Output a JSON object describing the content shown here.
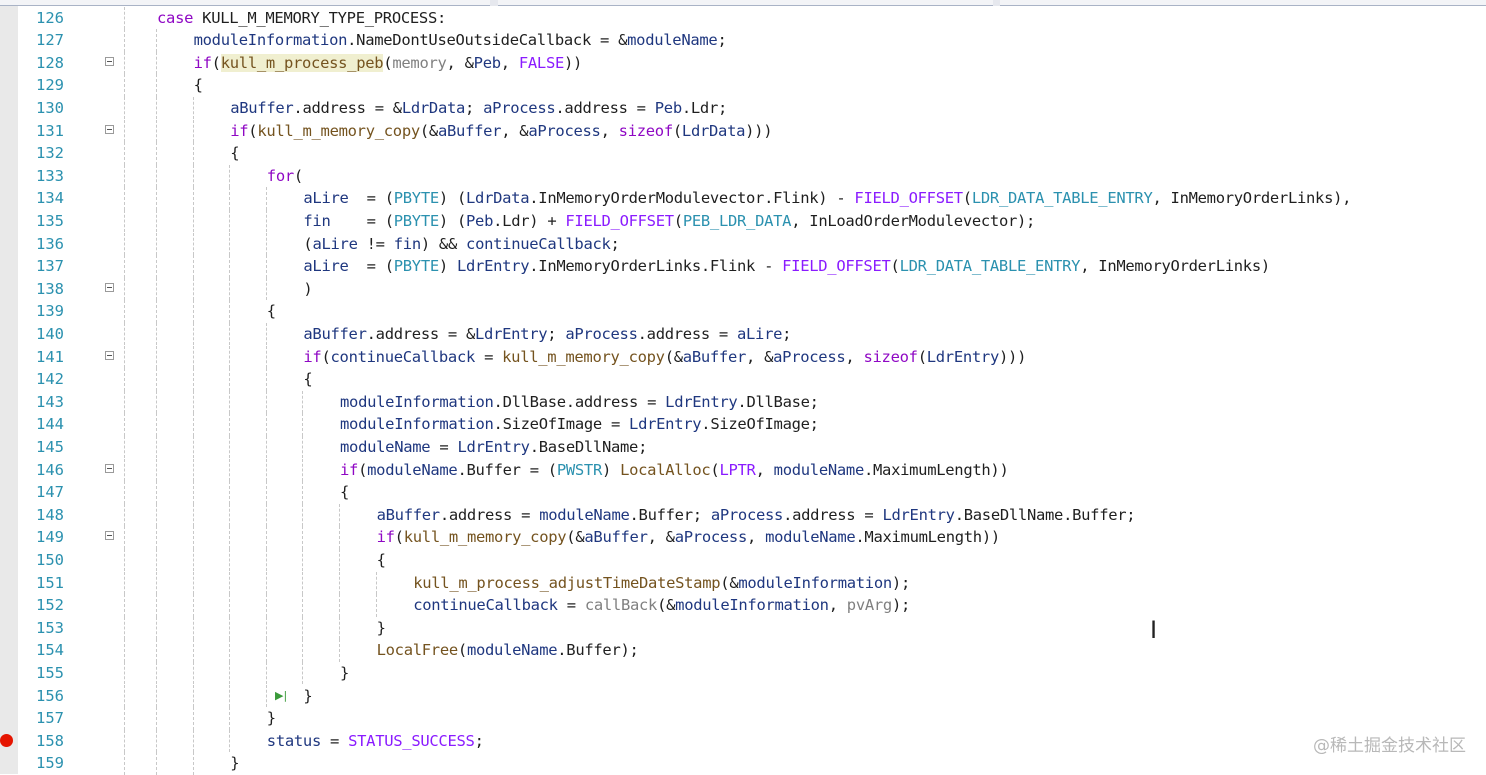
{
  "editor": {
    "lines": [
      {
        "num": "126",
        "indent": 0,
        "tokens": [
          [
            "kw",
            "case"
          ],
          [
            "pl",
            " KULL_M_MEMORY_TYPE_PROCESS:"
          ]
        ]
      },
      {
        "num": "127",
        "indent": 1,
        "tokens": [
          [
            "var",
            "moduleInformation"
          ],
          [
            "pl",
            ".NameDontUseOutsideCallback = &"
          ],
          [
            "var",
            "moduleName"
          ],
          [
            "pl",
            ";"
          ]
        ]
      },
      {
        "num": "128",
        "indent": 1,
        "fold": true,
        "tokens": [
          [
            "kw",
            "if"
          ],
          [
            "pl",
            "("
          ],
          [
            "fnhl",
            "kull_m_process_peb"
          ],
          [
            "pl",
            "("
          ],
          [
            "gray",
            "memory"
          ],
          [
            "pl",
            ", &"
          ],
          [
            "var",
            "Peb"
          ],
          [
            "pl",
            ", "
          ],
          [
            "mac",
            "FALSE"
          ],
          [
            "pl",
            "))"
          ]
        ]
      },
      {
        "num": "129",
        "indent": 1,
        "tokens": [
          [
            "pl",
            "{"
          ]
        ]
      },
      {
        "num": "130",
        "indent": 2,
        "tokens": [
          [
            "var",
            "aBuffer"
          ],
          [
            "pl",
            ".address = &"
          ],
          [
            "var",
            "LdrData"
          ],
          [
            "pl",
            "; "
          ],
          [
            "var",
            "aProcess"
          ],
          [
            "pl",
            ".address = "
          ],
          [
            "var",
            "Peb"
          ],
          [
            "pl",
            ".Ldr;"
          ]
        ]
      },
      {
        "num": "131",
        "indent": 2,
        "fold": true,
        "tokens": [
          [
            "kw",
            "if"
          ],
          [
            "pl",
            "("
          ],
          [
            "fn",
            "kull_m_memory_copy"
          ],
          [
            "pl",
            "(&"
          ],
          [
            "var",
            "aBuffer"
          ],
          [
            "pl",
            ", &"
          ],
          [
            "var",
            "aProcess"
          ],
          [
            "pl",
            ", "
          ],
          [
            "kw",
            "sizeof"
          ],
          [
            "pl",
            "("
          ],
          [
            "var",
            "LdrData"
          ],
          [
            "pl",
            ")))"
          ]
        ]
      },
      {
        "num": "132",
        "indent": 2,
        "tokens": [
          [
            "pl",
            "{"
          ]
        ]
      },
      {
        "num": "133",
        "indent": 3,
        "tokens": [
          [
            "kw",
            "for"
          ],
          [
            "pl",
            "("
          ]
        ]
      },
      {
        "num": "134",
        "indent": 4,
        "tokens": [
          [
            "var",
            "aLire"
          ],
          [
            "pl",
            "  = ("
          ],
          [
            "typ",
            "PBYTE"
          ],
          [
            "pl",
            ") ("
          ],
          [
            "var",
            "LdrData"
          ],
          [
            "pl",
            ".InMemoryOrderModulevector.Flink) - "
          ],
          [
            "mac",
            "FIELD_OFFSET"
          ],
          [
            "pl",
            "("
          ],
          [
            "typ",
            "LDR_DATA_TABLE_ENTRY"
          ],
          [
            "pl",
            ", InMemoryOrderLinks),"
          ]
        ]
      },
      {
        "num": "135",
        "indent": 4,
        "tokens": [
          [
            "var",
            "fin"
          ],
          [
            "pl",
            "    = ("
          ],
          [
            "typ",
            "PBYTE"
          ],
          [
            "pl",
            ") ("
          ],
          [
            "var",
            "Peb"
          ],
          [
            "pl",
            ".Ldr) + "
          ],
          [
            "mac",
            "FIELD_OFFSET"
          ],
          [
            "pl",
            "("
          ],
          [
            "typ",
            "PEB_LDR_DATA"
          ],
          [
            "pl",
            ", InLoadOrderModulevector);"
          ]
        ]
      },
      {
        "num": "136",
        "indent": 4,
        "tokens": [
          [
            "pl",
            "("
          ],
          [
            "var",
            "aLire"
          ],
          [
            "pl",
            " != "
          ],
          [
            "var",
            "fin"
          ],
          [
            "pl",
            ") && "
          ],
          [
            "var",
            "continueCallback"
          ],
          [
            "pl",
            ";"
          ]
        ]
      },
      {
        "num": "137",
        "indent": 4,
        "tokens": [
          [
            "var",
            "aLire"
          ],
          [
            "pl",
            "  = ("
          ],
          [
            "typ",
            "PBYTE"
          ],
          [
            "pl",
            ") "
          ],
          [
            "var",
            "LdrEntry"
          ],
          [
            "pl",
            ".InMemoryOrderLinks.Flink - "
          ],
          [
            "mac",
            "FIELD_OFFSET"
          ],
          [
            "pl",
            "("
          ],
          [
            "typ",
            "LDR_DATA_TABLE_ENTRY"
          ],
          [
            "pl",
            ", InMemoryOrderLinks)"
          ]
        ]
      },
      {
        "num": "138",
        "indent": 4,
        "fold": true,
        "tokens": [
          [
            "pl",
            ")"
          ]
        ]
      },
      {
        "num": "139",
        "indent": 3,
        "tokens": [
          [
            "pl",
            "{"
          ]
        ]
      },
      {
        "num": "140",
        "indent": 4,
        "tokens": [
          [
            "var",
            "aBuffer"
          ],
          [
            "pl",
            ".address = &"
          ],
          [
            "var",
            "LdrEntry"
          ],
          [
            "pl",
            "; "
          ],
          [
            "var",
            "aProcess"
          ],
          [
            "pl",
            ".address = "
          ],
          [
            "var",
            "aLire"
          ],
          [
            "pl",
            ";"
          ]
        ]
      },
      {
        "num": "141",
        "indent": 4,
        "fold": true,
        "tokens": [
          [
            "kw",
            "if"
          ],
          [
            "pl",
            "("
          ],
          [
            "var",
            "continueCallback"
          ],
          [
            "pl",
            " = "
          ],
          [
            "fn",
            "kull_m_memory_copy"
          ],
          [
            "pl",
            "(&"
          ],
          [
            "var",
            "aBuffer"
          ],
          [
            "pl",
            ", &"
          ],
          [
            "var",
            "aProcess"
          ],
          [
            "pl",
            ", "
          ],
          [
            "kw",
            "sizeof"
          ],
          [
            "pl",
            "("
          ],
          [
            "var",
            "LdrEntry"
          ],
          [
            "pl",
            ")))"
          ]
        ]
      },
      {
        "num": "142",
        "indent": 4,
        "tokens": [
          [
            "pl",
            "{"
          ]
        ]
      },
      {
        "num": "143",
        "indent": 5,
        "tokens": [
          [
            "var",
            "moduleInformation"
          ],
          [
            "pl",
            ".DllBase.address = "
          ],
          [
            "var",
            "LdrEntry"
          ],
          [
            "pl",
            ".DllBase;"
          ]
        ]
      },
      {
        "num": "144",
        "indent": 5,
        "tokens": [
          [
            "var",
            "moduleInformation"
          ],
          [
            "pl",
            ".SizeOfImage = "
          ],
          [
            "var",
            "LdrEntry"
          ],
          [
            "pl",
            ".SizeOfImage;"
          ]
        ]
      },
      {
        "num": "145",
        "indent": 5,
        "tokens": [
          [
            "var",
            "moduleName"
          ],
          [
            "pl",
            " = "
          ],
          [
            "var",
            "LdrEntry"
          ],
          [
            "pl",
            ".BaseDllName;"
          ]
        ]
      },
      {
        "num": "146",
        "indent": 5,
        "fold": true,
        "tokens": [
          [
            "kw",
            "if"
          ],
          [
            "pl",
            "("
          ],
          [
            "var",
            "moduleName"
          ],
          [
            "pl",
            ".Buffer = ("
          ],
          [
            "typ",
            "PWSTR"
          ],
          [
            "pl",
            ") "
          ],
          [
            "fn",
            "LocalAlloc"
          ],
          [
            "pl",
            "("
          ],
          [
            "mac",
            "LPTR"
          ],
          [
            "pl",
            ", "
          ],
          [
            "var",
            "moduleName"
          ],
          [
            "pl",
            ".MaximumLength))"
          ]
        ]
      },
      {
        "num": "147",
        "indent": 5,
        "tokens": [
          [
            "pl",
            "{"
          ]
        ]
      },
      {
        "num": "148",
        "indent": 6,
        "tokens": [
          [
            "var",
            "aBuffer"
          ],
          [
            "pl",
            ".address = "
          ],
          [
            "var",
            "moduleName"
          ],
          [
            "pl",
            ".Buffer; "
          ],
          [
            "var",
            "aProcess"
          ],
          [
            "pl",
            ".address = "
          ],
          [
            "var",
            "LdrEntry"
          ],
          [
            "pl",
            ".BaseDllName.Buffer;"
          ]
        ]
      },
      {
        "num": "149",
        "indent": 6,
        "fold": true,
        "tokens": [
          [
            "kw",
            "if"
          ],
          [
            "pl",
            "("
          ],
          [
            "fn",
            "kull_m_memory_copy"
          ],
          [
            "pl",
            "(&"
          ],
          [
            "var",
            "aBuffer"
          ],
          [
            "pl",
            ", &"
          ],
          [
            "var",
            "aProcess"
          ],
          [
            "pl",
            ", "
          ],
          [
            "var",
            "moduleName"
          ],
          [
            "pl",
            ".MaximumLength))"
          ]
        ]
      },
      {
        "num": "150",
        "indent": 6,
        "tokens": [
          [
            "pl",
            "{"
          ]
        ]
      },
      {
        "num": "151",
        "indent": 7,
        "tokens": [
          [
            "fn",
            "kull_m_process_adjustTimeDateStamp"
          ],
          [
            "pl",
            "(&"
          ],
          [
            "var",
            "moduleInformation"
          ],
          [
            "pl",
            ");"
          ]
        ]
      },
      {
        "num": "152",
        "indent": 7,
        "tokens": [
          [
            "var",
            "continueCallback"
          ],
          [
            "pl",
            " = "
          ],
          [
            "gray",
            "callBack"
          ],
          [
            "pl",
            "(&"
          ],
          [
            "var",
            "moduleInformation"
          ],
          [
            "pl",
            ", "
          ],
          [
            "gray",
            "pvArg"
          ],
          [
            "pl",
            ");"
          ]
        ]
      },
      {
        "num": "153",
        "indent": 6,
        "tokens": [
          [
            "pl",
            "}"
          ]
        ]
      },
      {
        "num": "154",
        "indent": 6,
        "tokens": [
          [
            "fn",
            "LocalFree"
          ],
          [
            "pl",
            "("
          ],
          [
            "var",
            "moduleName"
          ],
          [
            "pl",
            ".Buffer);"
          ]
        ]
      },
      {
        "num": "155",
        "indent": 5,
        "tokens": [
          [
            "pl",
            "}"
          ]
        ]
      },
      {
        "num": "156",
        "indent": 4,
        "run": true,
        "tokens": [
          [
            "pl",
            "}"
          ]
        ]
      },
      {
        "num": "157",
        "indent": 3,
        "tokens": [
          [
            "pl",
            "}"
          ]
        ]
      },
      {
        "num": "158",
        "indent": 3,
        "breakpoint": true,
        "tokens": [
          [
            "var",
            "status"
          ],
          [
            "pl",
            " = "
          ],
          [
            "mac",
            "STATUS_SUCCESS"
          ],
          [
            "pl",
            ";"
          ]
        ]
      },
      {
        "num": "159",
        "indent": 2,
        "tokens": [
          [
            "pl",
            "}"
          ]
        ]
      }
    ]
  },
  "watermark": "@稀土掘金技术社区"
}
